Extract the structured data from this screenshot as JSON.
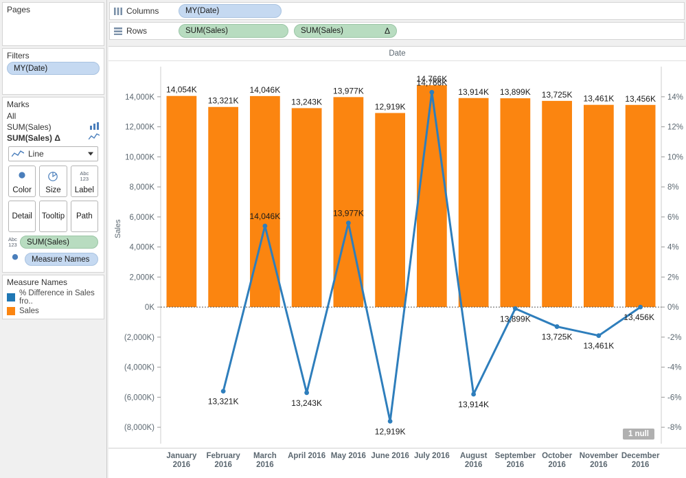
{
  "left_panel": {
    "pages": {
      "title": "Pages"
    },
    "filters": {
      "title": "Filters",
      "pills": [
        {
          "label": "MY(Date)"
        }
      ]
    },
    "marks": {
      "title": "Marks",
      "rows": [
        {
          "label": "All",
          "icon": ""
        },
        {
          "label": "SUM(Sales)",
          "icon": "bar-chart-icon"
        },
        {
          "label": "SUM(Sales)",
          "suffix": "Δ",
          "icon": "line-chart-icon",
          "bold": true
        }
      ],
      "mark_type": "Line",
      "properties": [
        {
          "label": "Color",
          "icon": "color-icon"
        },
        {
          "label": "Size",
          "icon": "size-icon"
        },
        {
          "label": "Label",
          "icon": "abc123-icon"
        },
        {
          "label": "Detail",
          "icon": ""
        },
        {
          "label": "Tooltip",
          "icon": ""
        },
        {
          "label": "Path",
          "icon": ""
        }
      ],
      "pills": [
        {
          "label": "SUM(Sales)",
          "icon": "abc123-icon",
          "kind": "green"
        },
        {
          "label": "Measure Names",
          "icon": "color-icon",
          "kind": "blue"
        }
      ]
    },
    "legend": {
      "title": "Measure Names",
      "items": [
        {
          "label": "% Difference in Sales fro..",
          "color": "#1f77b4"
        },
        {
          "label": "Sales",
          "color": "#fb8510"
        }
      ]
    }
  },
  "shelves": {
    "columns": {
      "label": "Columns",
      "icon": "columns-icon",
      "pills": [
        {
          "label": "MY(Date)",
          "kind": "blue"
        }
      ]
    },
    "rows": {
      "label": "Rows",
      "icon": "rows-icon",
      "pills": [
        {
          "label": "SUM(Sales)",
          "kind": "green",
          "suffix": ""
        },
        {
          "label": "SUM(Sales)",
          "kind": "green",
          "suffix": "Δ"
        }
      ]
    }
  },
  "viz": {
    "column_header": "Date",
    "y_axis_title": "Sales",
    "null_badge": "1 null"
  },
  "colors": {
    "bar": "#fb8510",
    "line": "#2e7ebc",
    "pill_blue": "#c5d9f1",
    "pill_green": "#b8dcc0",
    "axis_text": "#5b6770"
  },
  "chart_data": {
    "type": "bar",
    "title": "Date",
    "xlabel": "",
    "ylabel": "Sales",
    "categories": [
      "January 2016",
      "February 2016",
      "March 2016",
      "April 2016",
      "May 2016",
      "June 2016",
      "July 2016",
      "August 2016",
      "September 2016",
      "October 2016",
      "November 2016",
      "December 2016"
    ],
    "left_axis": {
      "ticks": [
        "14,000K",
        "12,000K",
        "10,000K",
        "8,000K",
        "6,000K",
        "4,000K",
        "2,000K",
        "0K",
        "(2,000K)",
        "(4,000K)",
        "(6,000K)",
        "(8,000K)"
      ],
      "tick_values": [
        14000,
        12000,
        10000,
        8000,
        6000,
        4000,
        2000,
        0,
        -2000,
        -4000,
        -6000,
        -8000
      ],
      "ylim": [
        -9000,
        15000
      ]
    },
    "right_axis": {
      "ticks": [
        "14%",
        "12%",
        "10%",
        "8%",
        "6%",
        "4%",
        "2%",
        "0%",
        "-2%",
        "-4%",
        "-6%",
        "-8%"
      ],
      "tick_values": [
        14,
        12,
        10,
        8,
        6,
        4,
        2,
        0,
        -2,
        -4,
        -6,
        -8
      ],
      "ylim": [
        -9,
        15
      ]
    },
    "grid": false,
    "legend_position": "left-panel",
    "series": [
      {
        "name": "Sales",
        "type": "bar",
        "color": "#fb8510",
        "axis": "left",
        "values": [
          14054,
          13321,
          14046,
          13243,
          13977,
          12919,
          14766,
          13914,
          13899,
          13725,
          13461,
          13456
        ],
        "labels": [
          "14,054K",
          "13,321K",
          "14,046K",
          "13,243K",
          "13,977K",
          "12,919K",
          "14,766K",
          "13,914K",
          "13,899K",
          "13,725K",
          "13,461K",
          "13,456K"
        ]
      },
      {
        "name": "% Difference in Sales fro..",
        "type": "line",
        "color": "#2e7ebc",
        "axis": "right",
        "values": [
          null,
          -5.6,
          5.4,
          -5.7,
          5.6,
          -7.6,
          14.3,
          -5.8,
          -0.1,
          -1.3,
          -1.9,
          0.0
        ],
        "labels": [
          null,
          "13,321K",
          "14,046K",
          "13,243K",
          "13,977K",
          "12,919K",
          "14,766K",
          "13,914K",
          "13,899K",
          "13,725K",
          "13,461K",
          "13,456K"
        ]
      }
    ]
  }
}
